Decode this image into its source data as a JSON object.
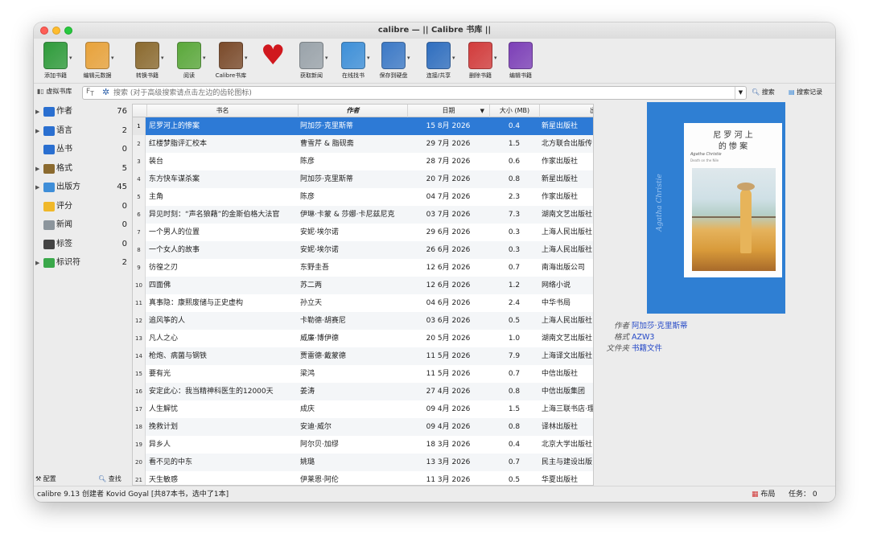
{
  "window_title": "calibre — || Calibre 书库 ||",
  "toolbar": [
    {
      "label": "添加书籍",
      "icon": "add-book-icon",
      "color": "#2e9b3a",
      "has_menu": true
    },
    {
      "label": "编辑元数据",
      "icon": "edit-metadata-icon",
      "color": "#e8a23a",
      "has_menu": true
    },
    {
      "label": "转换书籍",
      "icon": "convert-book-icon",
      "color": "#8b6a2f",
      "has_menu": true
    },
    {
      "label": "阅读",
      "icon": "read-book-icon",
      "color": "#5aa83a",
      "has_menu": true
    },
    {
      "label": "Calibre书库",
      "icon": "library-icon",
      "color": "#7a4a2a",
      "has_menu": true
    },
    {
      "label": "",
      "icon": "donate-heart-icon",
      "color": "#d0181e",
      "has_menu": false
    },
    {
      "label": "获取新闻",
      "icon": "fetch-news-icon",
      "color": "#9aa3aa",
      "has_menu": true
    },
    {
      "label": "在线找书",
      "icon": "get-books-icon",
      "color": "#3d8fd8",
      "has_menu": true
    },
    {
      "label": "保存到硬盘",
      "icon": "save-to-disk-icon",
      "color": "#3c79c6",
      "has_menu": true
    },
    {
      "label": "连接/共享",
      "icon": "connect-share-icon",
      "color": "#2f6ebf",
      "has_menu": true
    },
    {
      "label": "删除书籍",
      "icon": "remove-books-icon",
      "color": "#d23b3b",
      "has_menu": true
    },
    {
      "label": "编辑书籍",
      "icon": "edit-book-icon",
      "color": "#7c3fb7",
      "has_menu": false
    }
  ],
  "search": {
    "virtual_library": "虚拟书库",
    "placeholder": "搜索 (对于高级搜索请点击左边的齿轮图标)",
    "search_button": "搜索",
    "saved_searches": "搜索记录"
  },
  "sidebar": {
    "items": [
      {
        "name": "作者",
        "count": "76",
        "expandable": true,
        "icon": "author-icon"
      },
      {
        "name": "语言",
        "count": "2",
        "expandable": true,
        "icon": "language-icon"
      },
      {
        "name": "丛书",
        "count": "0",
        "expandable": false,
        "icon": "series-icon"
      },
      {
        "name": "格式",
        "count": "5",
        "expandable": true,
        "icon": "format-icon"
      },
      {
        "name": "出版方",
        "count": "45",
        "expandable": true,
        "icon": "publisher-icon"
      },
      {
        "name": "评分",
        "count": "0",
        "expandable": false,
        "icon": "rating-icon"
      },
      {
        "name": "新闻",
        "count": "0",
        "expandable": false,
        "icon": "news-icon"
      },
      {
        "name": "标签",
        "count": "0",
        "expandable": false,
        "icon": "tag-icon"
      },
      {
        "name": "标识符",
        "count": "2",
        "expandable": true,
        "icon": "identifier-icon"
      }
    ],
    "configure": "配置",
    "find": "查找"
  },
  "table": {
    "headers": {
      "title": "书名",
      "author": "作者",
      "date": "日期",
      "size": "大小 (MB)",
      "publisher": "出版"
    },
    "rows": [
      {
        "n": "1",
        "title": "尼罗河上的惨案",
        "author": "阿加莎·克里斯蒂",
        "date": "15 8月 2026",
        "size": "0.4",
        "publisher": "新星出版社"
      },
      {
        "n": "2",
        "title": "红楼梦脂评汇校本",
        "author": "曹雪芹 & 脂砚斋",
        "date": "29 7月 2026",
        "size": "1.5",
        "publisher": "北方联合出版传"
      },
      {
        "n": "3",
        "title": "装台",
        "author": "陈彦",
        "date": "28 7月 2026",
        "size": "0.6",
        "publisher": "作家出版社"
      },
      {
        "n": "4",
        "title": "东方快车谋杀案",
        "author": "阿加莎·克里斯蒂",
        "date": "20 7月 2026",
        "size": "0.8",
        "publisher": "新星出版社"
      },
      {
        "n": "5",
        "title": "主角",
        "author": "陈彦",
        "date": "04 7月 2026",
        "size": "2.3",
        "publisher": "作家出版社"
      },
      {
        "n": "6",
        "title": "异见时刻：“声名狼藉”的金斯伯格大法官",
        "author": "伊琳·卡蒙 & 莎娜·卡尼兹尼克",
        "date": "03 7月 2026",
        "size": "7.3",
        "publisher": "湖南文艺出版社"
      },
      {
        "n": "7",
        "title": "一个男人的位置",
        "author": "安妮·埃尔诺",
        "date": "29 6月 2026",
        "size": "0.3",
        "publisher": "上海人民出版社"
      },
      {
        "n": "8",
        "title": "一个女人的故事",
        "author": "安妮·埃尔诺",
        "date": "26 6月 2026",
        "size": "0.3",
        "publisher": "上海人民出版社"
      },
      {
        "n": "9",
        "title": "彷徨之刃",
        "author": "东野圭吾",
        "date": "12 6月 2026",
        "size": "0.7",
        "publisher": "南海出版公司"
      },
      {
        "n": "10",
        "title": "四面佛",
        "author": "苏二两",
        "date": "12 6月 2026",
        "size": "1.2",
        "publisher": "网络小说"
      },
      {
        "n": "11",
        "title": "真事隐：康熙废储与正史虚构",
        "author": "孙立天",
        "date": "04 6月 2026",
        "size": "2.4",
        "publisher": "中华书局"
      },
      {
        "n": "12",
        "title": "追风筝的人",
        "author": "卡勒德·胡赛尼",
        "date": "03 6月 2026",
        "size": "0.5",
        "publisher": "上海人民出版社"
      },
      {
        "n": "13",
        "title": "凡人之心",
        "author": "威廉·博伊德",
        "date": "20 5月 2026",
        "size": "1.0",
        "publisher": "湖南文艺出版社"
      },
      {
        "n": "14",
        "title": "枪炮、病菌与钢铁",
        "author": "贾雷德·戴蒙德",
        "date": "11 5月 2026",
        "size": "7.9",
        "publisher": "上海译文出版社"
      },
      {
        "n": "15",
        "title": "要有光",
        "author": "梁鸿",
        "date": "11 5月 2026",
        "size": "0.7",
        "publisher": "中信出版社"
      },
      {
        "n": "16",
        "title": "安定此心：我当精神科医生的12000天",
        "author": "姜涛",
        "date": "27 4月 2026",
        "size": "0.8",
        "publisher": "中信出版集团"
      },
      {
        "n": "17",
        "title": "人生解忧",
        "author": "成庆",
        "date": "09 4月 2026",
        "size": "1.5",
        "publisher": "上海三联书店·理"
      },
      {
        "n": "18",
        "title": "挽救计划",
        "author": "安迪·威尔",
        "date": "09 4月 2026",
        "size": "0.8",
        "publisher": "译林出版社"
      },
      {
        "n": "19",
        "title": "异乡人",
        "author": "阿尔贝·加缪",
        "date": "18 3月 2026",
        "size": "0.4",
        "publisher": "北京大学出版社"
      },
      {
        "n": "20",
        "title": "看不见的中东",
        "author": "姚璐",
        "date": "13 3月 2026",
        "size": "0.7",
        "publisher": "民主与建设出版"
      },
      {
        "n": "21",
        "title": "天生敏感",
        "author": "伊莱恩·阿伦",
        "date": "11 3月 2026",
        "size": "0.5",
        "publisher": "华夏出版社"
      }
    ]
  },
  "details": {
    "cover_title_line1": "尼 罗 河 上",
    "cover_title_line2": "的  惨  案",
    "cover_author_en": "Agatha Christie",
    "cover_subtitle_en": "Death on the Nile",
    "cover_spine_text": "Agatha Christie",
    "fields": [
      {
        "key": "作者",
        "value": "阿加莎·克里斯蒂"
      },
      {
        "key": "格式",
        "value": "AZW3"
      },
      {
        "key": "文件夹",
        "value": "书籍文件"
      }
    ]
  },
  "status": {
    "left": "calibre 9.13  创建者 Kovid Goyal  [共87本书，选中了1本]",
    "layout": "布局",
    "jobs": "任务： 0"
  },
  "colors": {
    "selection": "#2d7ad6",
    "cover_blue": "#2f7fd3",
    "link": "#2549c7"
  }
}
